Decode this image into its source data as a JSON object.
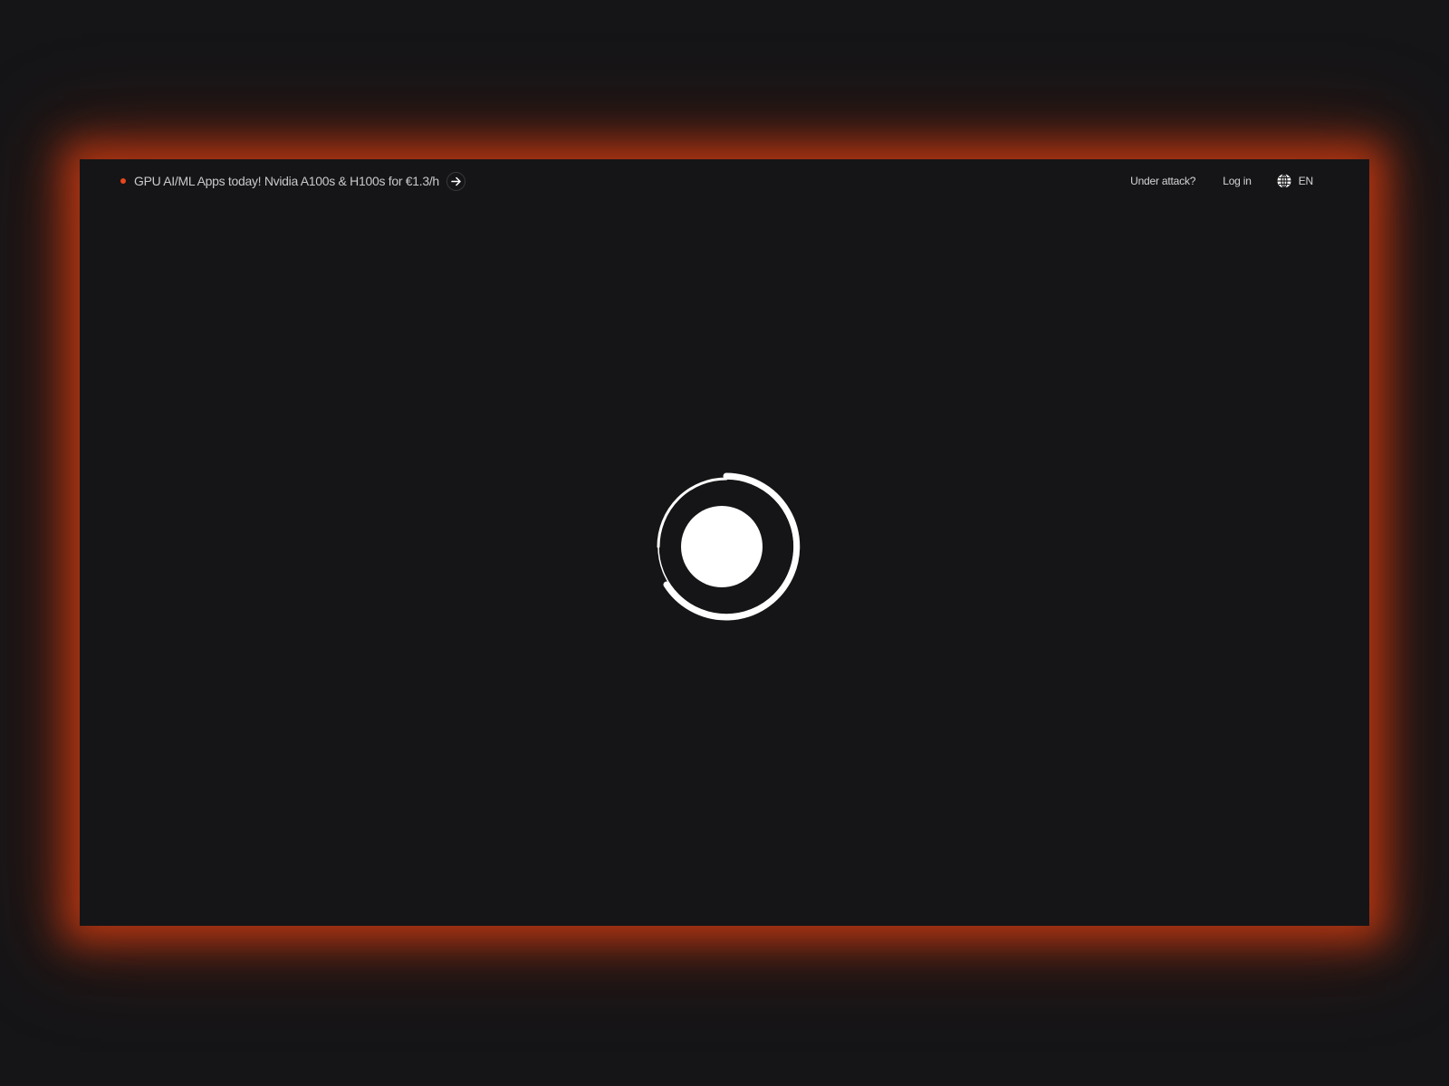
{
  "promo": {
    "text": "GPU AI/ML Apps today! Nvidia A100s & H100s for €1.3/h",
    "dot_color": "#e8471c",
    "arrow_icon": "arrow-right-icon"
  },
  "nav": {
    "under_attack": "Under attack?",
    "login": "Log in",
    "language": "EN",
    "language_icon": "globe-icon"
  },
  "loader": {
    "icon": "spinner-icon",
    "color": "#ffffff"
  },
  "theme": {
    "background": "#151517",
    "glow": "#d63e12"
  }
}
